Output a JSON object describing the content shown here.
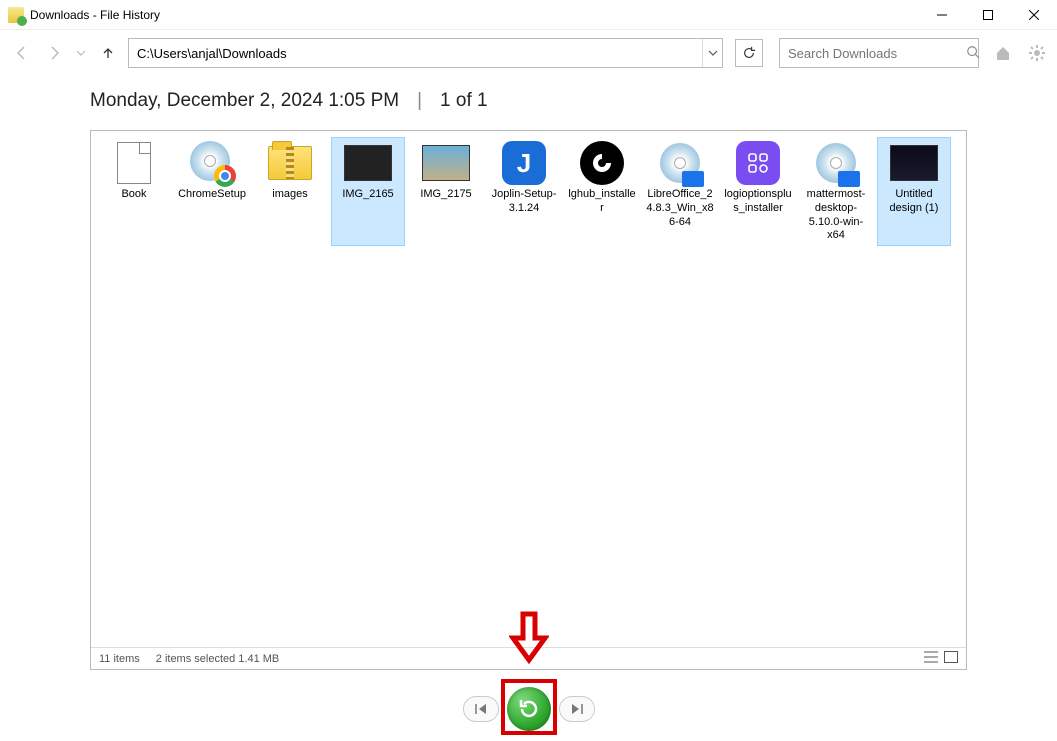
{
  "window": {
    "title": "Downloads - File History"
  },
  "toolbar": {
    "path": "C:\\Users\\anjal\\Downloads",
    "search_placeholder": "Search Downloads"
  },
  "header": {
    "timestamp": "Monday, December 2, 2024 1:05 PM",
    "position": "1 of 1"
  },
  "files": [
    {
      "name": "Book",
      "icon": "doc",
      "selected": false
    },
    {
      "name": "ChromeSetup",
      "icon": "chrome-installer",
      "selected": false
    },
    {
      "name": "images",
      "icon": "zip-folder",
      "selected": false
    },
    {
      "name": "IMG_2165",
      "icon": "img-dark",
      "selected": true
    },
    {
      "name": "IMG_2175",
      "icon": "img-light",
      "selected": false
    },
    {
      "name": "Joplin-Setup-3.1.24",
      "icon": "joplin",
      "selected": false
    },
    {
      "name": "lghub_installer",
      "icon": "lghub",
      "selected": false
    },
    {
      "name": "LibreOffice_24.8.3_Win_x86-64",
      "icon": "disc-blue",
      "selected": false
    },
    {
      "name": "logioptionsplus_installer",
      "icon": "logi-options",
      "selected": false
    },
    {
      "name": "mattermost-desktop-5.10.0-win-x64",
      "icon": "disc-blue",
      "selected": false
    },
    {
      "name": "Untitled design (1)",
      "icon": "img-dark2",
      "selected": true
    }
  ],
  "status": {
    "item_count": "11 items",
    "selection": "2 items selected  1.41 MB"
  }
}
